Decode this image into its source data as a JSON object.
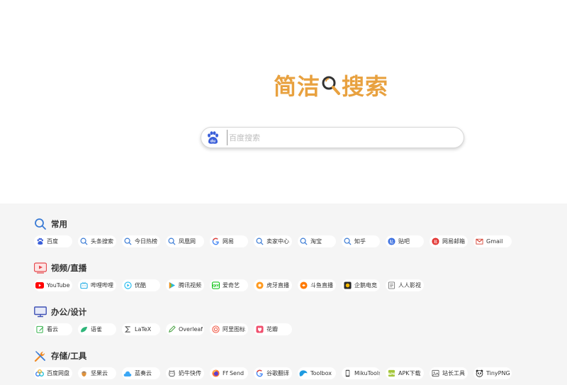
{
  "logo": {
    "part1": "简洁",
    "part2": "搜索"
  },
  "search": {
    "placeholder": "百度搜索",
    "value": ""
  },
  "sections": [
    {
      "title": "常用",
      "icon": "search-icon",
      "items": [
        {
          "label": "百度",
          "icon": "baidu-paw-icon"
        },
        {
          "label": "头条搜索",
          "icon": "search-icon"
        },
        {
          "label": "今日热榜",
          "icon": "search-icon"
        },
        {
          "label": "凤凰网",
          "icon": "search-icon"
        },
        {
          "label": "网易",
          "icon": "google-icon"
        },
        {
          "label": "卖家中心",
          "icon": "search-icon"
        },
        {
          "label": "淘宝",
          "icon": "search-icon"
        },
        {
          "label": "知乎",
          "icon": "search-icon"
        },
        {
          "label": "贴吧",
          "icon": "tieba-icon"
        },
        {
          "label": "网易邮箱",
          "icon": "netease-mail-icon"
        },
        {
          "label": "Gmail",
          "icon": "gmail-icon"
        }
      ]
    },
    {
      "title": "视频/直播",
      "icon": "video-icon",
      "items": [
        {
          "label": "YouTube",
          "icon": "youtube-icon"
        },
        {
          "label": "哔哩哔哩",
          "icon": "bilibili-icon"
        },
        {
          "label": "优酷",
          "icon": "youku-icon"
        },
        {
          "label": "腾讯视频",
          "icon": "tencent-video-icon"
        },
        {
          "label": "爱奇艺",
          "icon": "iqiyi-icon"
        },
        {
          "label": "虎牙直播",
          "icon": "huya-icon"
        },
        {
          "label": "斗鱼直播",
          "icon": "douyu-icon"
        },
        {
          "label": "企鹅电竞",
          "icon": "penguin-esports-icon"
        },
        {
          "label": "人人影视",
          "icon": "document-icon"
        }
      ]
    },
    {
      "title": "办公/设计",
      "icon": "monitor-icon",
      "items": [
        {
          "label": "看云",
          "icon": "edit-icon"
        },
        {
          "label": "语雀",
          "icon": "yuque-icon"
        },
        {
          "label": "LaTeX",
          "icon": "sigma-icon"
        },
        {
          "label": "Overleaf",
          "icon": "pencil-icon"
        },
        {
          "label": "阿里图标",
          "icon": "iconfont-icon"
        },
        {
          "label": "花瓣",
          "icon": "huaban-icon"
        }
      ]
    },
    {
      "title": "存储/工具",
      "icon": "tools-icon",
      "items": [
        {
          "label": "百度网盘",
          "icon": "baidu-pan-icon"
        },
        {
          "label": "坚果云",
          "icon": "nut-icon"
        },
        {
          "label": "蓝奏云",
          "icon": "cloud-icon"
        },
        {
          "label": "奶牛快传",
          "icon": "cow-icon"
        },
        {
          "label": "Ff Send",
          "icon": "firefox-icon"
        },
        {
          "label": "谷歌翻译",
          "icon": "google-icon"
        },
        {
          "label": "Toolbox",
          "icon": "toolbox-icon"
        },
        {
          "label": "MikuTools",
          "icon": "phone-icon"
        },
        {
          "label": "APK下载",
          "icon": "apk-icon"
        },
        {
          "label": "站长工具",
          "icon": "image-icon"
        },
        {
          "label": "TinyPNG",
          "icon": "panda-icon"
        }
      ]
    }
  ]
}
